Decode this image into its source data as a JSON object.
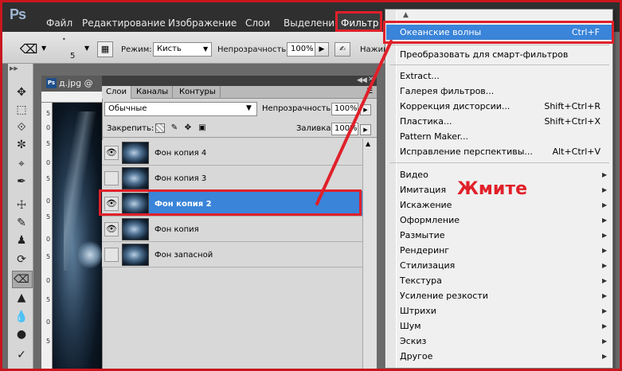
{
  "app": {
    "logo": "Ps"
  },
  "menubar": {
    "items": [
      "Файл",
      "Редактирование",
      "Изображение",
      "Слои",
      "Выделение",
      "Фильтр"
    ],
    "highlighted": "Фильтр"
  },
  "options_bar": {
    "brush_size": "5",
    "mode_label": "Режим:",
    "mode_value": "Кисть",
    "opacity_label": "Непрозрачность:",
    "opacity_value": "100%",
    "press_label": "Нажим"
  },
  "document": {
    "tab_title": "д.jpg @",
    "ruler_left": [
      "5",
      "0",
      "5",
      "0",
      "5",
      "0",
      "5",
      "0",
      "5",
      "0",
      "5",
      "0",
      "5"
    ]
  },
  "layers_panel": {
    "tabs": [
      "Слои",
      "Каналы",
      "Контуры"
    ],
    "active_tab": "Слои",
    "blend_mode": "Обычные",
    "opacity_label": "Непрозрачность:",
    "opacity_value": "100%",
    "lock_label": "Закрепить:",
    "fill_label": "Заливка:",
    "fill_value": "100%",
    "layers": [
      {
        "name": "Фон копия 4",
        "visible": true,
        "selected": false
      },
      {
        "name": "Фон копия 3",
        "visible": false,
        "selected": false
      },
      {
        "name": "Фон копия 2",
        "visible": true,
        "selected": true
      },
      {
        "name": "Фон копия",
        "visible": true,
        "selected": false
      },
      {
        "name": "Фон запасной",
        "visible": false,
        "selected": false
      }
    ]
  },
  "filter_menu": {
    "top_items": [
      {
        "label": "Океанские волны",
        "shortcut": "Ctrl+F",
        "highlighted": true
      },
      {
        "label": "Преобразовать для смарт-фильтров",
        "shortcut": ""
      }
    ],
    "middle_items": [
      {
        "label": "Extract...",
        "shortcut": ""
      },
      {
        "label": "Галерея фильтров...",
        "shortcut": ""
      },
      {
        "label": "Коррекция дисторсии...",
        "shortcut": "Shift+Ctrl+R"
      },
      {
        "label": "Пластика...",
        "shortcut": "Shift+Ctrl+X"
      },
      {
        "label": "Pattern Maker...",
        "shortcut": ""
      },
      {
        "label": "Исправление перспективы...",
        "shortcut": "Alt+Ctrl+V"
      }
    ],
    "submenus": [
      "Видео",
      "Имитация",
      "Искажение",
      "Оформление",
      "Размытие",
      "Рендеринг",
      "Стилизация",
      "Текстура",
      "Усиление резкости",
      "Штрихи",
      "Шум",
      "Эскиз",
      "Другое"
    ]
  },
  "annotation": {
    "text": "Жмите",
    "color": "#e0202a"
  },
  "colors": {
    "highlight": "#3a84d9",
    "annotation_red": "#e0202a",
    "menubar": "#2f2f2f"
  }
}
